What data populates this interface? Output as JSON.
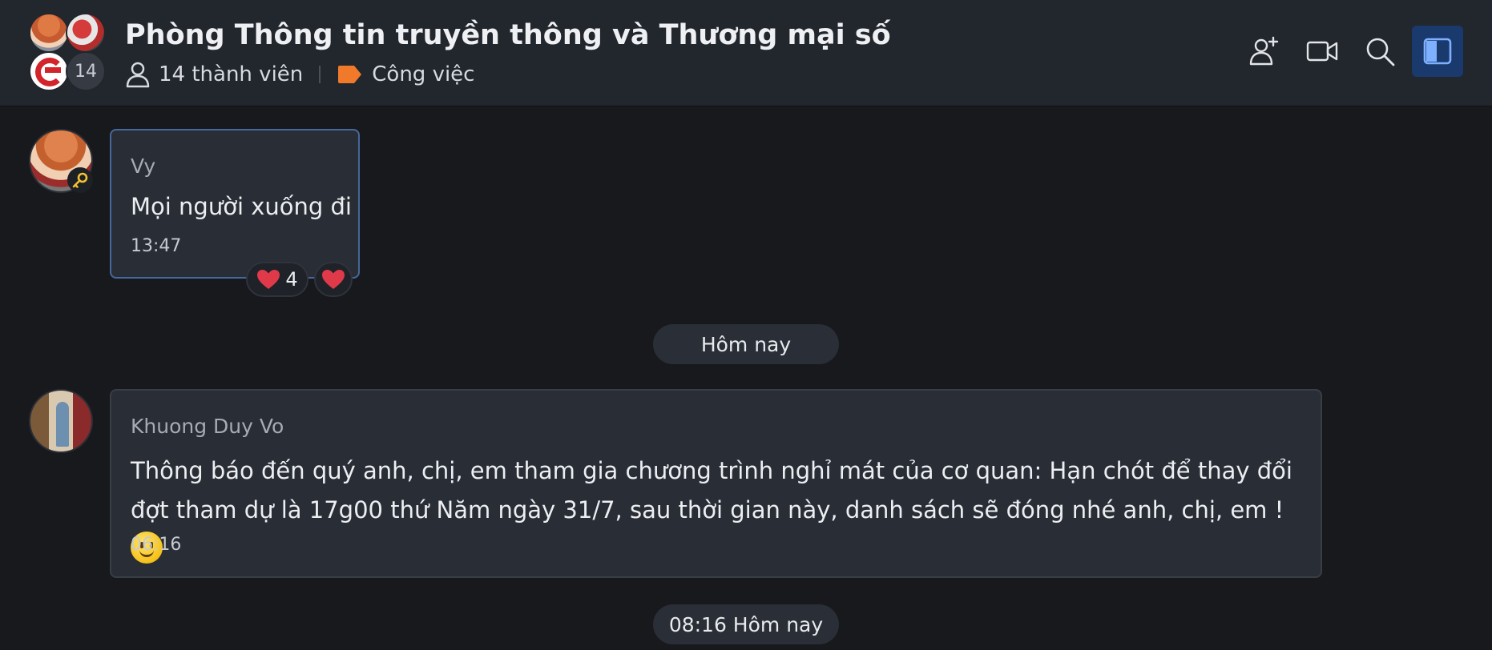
{
  "header": {
    "title": "Phòng Thông tin truyền thông và Thương mại số",
    "member_count_badge": "14",
    "members_label": "14 thành viên",
    "tag_label": "Công việc",
    "tag_color": "#f07a2a",
    "icons": [
      "add-member-icon",
      "video-call-icon",
      "search-icon",
      "side-panel-icon"
    ]
  },
  "messages": [
    {
      "sender": "Vy",
      "text": "Mọi người xuống đi",
      "time": "13:47",
      "reactions": [
        {
          "emoji": "heart",
          "count": "4"
        },
        {
          "emoji": "heart"
        }
      ]
    },
    {
      "sender": "Khuong Duy Vo",
      "text": "Thông báo đến quý anh, chị, em tham gia chương trình nghỉ mát của cơ quan: Hạn chót để thay đổi đợt tham dự là 17g00 thứ Năm ngày 31/7, sau thời gian này, danh sách sẽ đóng nhé anh, chị, em !",
      "time": "06:16"
    }
  ],
  "separators": {
    "today": "Hôm nay",
    "today_with_time": "08:16 Hôm nay"
  },
  "colors": {
    "background": "#17191d",
    "header": "#22262d",
    "bubble": "#292d35",
    "selected_border": "#46689c",
    "heart": "#e03a4a"
  }
}
